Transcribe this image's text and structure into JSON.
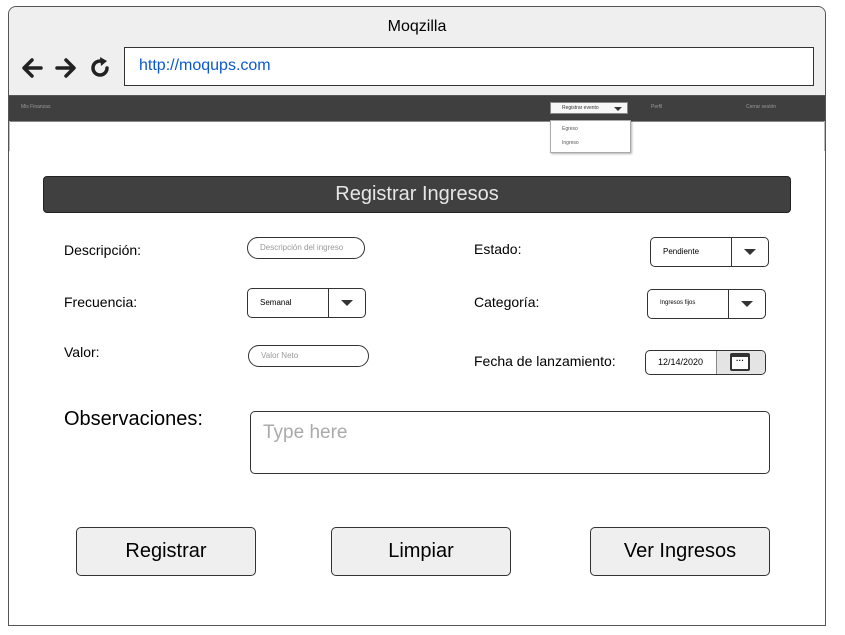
{
  "browser": {
    "window_title": "Moqzilla",
    "url": "http://moqups.com"
  },
  "nav": {
    "brand": "Mis Finanzas",
    "register_event": "Registrar evento",
    "perfil": "Perfil",
    "logout": "Cerrar sesión",
    "dropdown_items": [
      "Egreso",
      "Ingreso"
    ]
  },
  "form": {
    "header": "Registrar Ingresos",
    "descripcion_label": "Descripción:",
    "descripcion_placeholder": "Descripción del ingreso",
    "frecuencia_label": "Frecuencia:",
    "frecuencia_value": "Semanal",
    "valor_label": "Valor:",
    "valor_placeholder": "Valor Neto",
    "estado_label": "Estado:",
    "estado_value": "Pendiente",
    "categoria_label": "Categoría:",
    "categoria_value": "Ingresos fijos",
    "fecha_label": "Fecha de lanzamiento:",
    "fecha_value": "12/14/2020",
    "observaciones_label": "Observaciones:",
    "observaciones_placeholder": "Type here"
  },
  "buttons": {
    "registrar": "Registrar",
    "limpiar": "Limpiar",
    "ver_ingresos": "Ver Ingresos"
  },
  "colors": {
    "header_bar": "#404040",
    "nav_bar": "#3f3f3f",
    "url_text": "#0b58d3",
    "button_bg": "#efefef"
  },
  "icons": [
    "back-arrow-icon",
    "forward-arrow-icon",
    "reload-icon",
    "chevron-down-icon",
    "calendar-icon"
  ]
}
